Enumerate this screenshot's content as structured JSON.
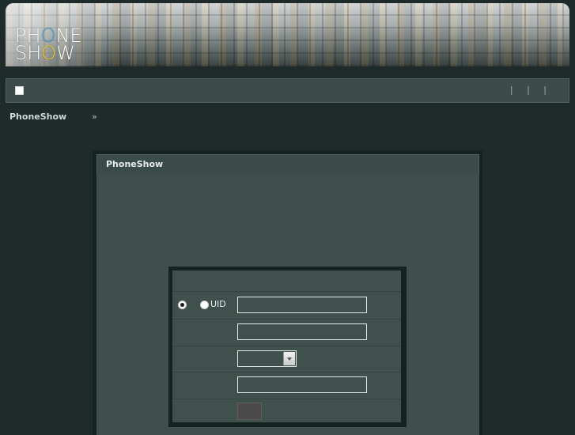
{
  "banner": {
    "logo_top": "PHONE",
    "logo_bottom": "SHOW",
    "logo_o_top_color": "#3fa9e0",
    "logo_o_bottom_color": "#f0d21a"
  },
  "navbar": {
    "separators": [
      "|",
      "|",
      "|"
    ]
  },
  "breadcrumb": {
    "home": "PhoneShow",
    "separator": "»"
  },
  "panel": {
    "title": "PhoneShow"
  },
  "login_form": {
    "uid_label": "UID",
    "username_value": "",
    "password_value": "",
    "answer_value": ""
  },
  "colors": {
    "page_bg": "#1f2b2a",
    "panel_bg": "#3e4f4c",
    "navbar_bg": "#3b4c4a"
  }
}
